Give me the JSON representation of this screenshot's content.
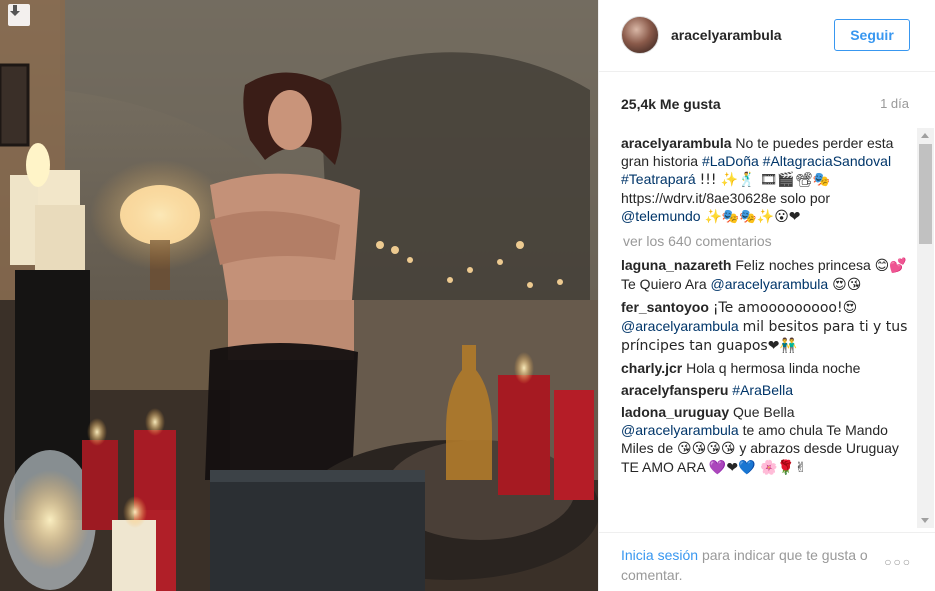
{
  "post": {
    "username": "aracelyarambula",
    "follow_label": "Seguir",
    "likes": "25,4k Me gusta",
    "time": "1 día",
    "caption": {
      "user": "aracelyarambula",
      "text1": "No te puedes perder esta gran historia",
      "tag1": "#LaDoña",
      "tag2": "#AltagraciaSandoval",
      "tag3": "#Teatrapará",
      "text2": "!!! ✨🕺",
      "emoji1": "🎞🎬📽🎭",
      "text3": "https://wdrv.it/8ae30628e solo por",
      "tag4": "@telemundo",
      "emoji2": "✨🎭🎭✨😮❤"
    },
    "view_comments": "ver los 640 comentarios",
    "comments": [
      {
        "user": "laguna_nazareth",
        "text1": "Feliz noches princesa",
        "emoji1": "😊💕",
        "text2": "Te Quiero Ara",
        "tag": "@aracelyarambula",
        "emoji2": "😍😘"
      },
      {
        "user": "fer_santoyoo",
        "text1": "¡Te amooooooooo!😍",
        "tag": "@aracelyarambula",
        "text2": "mil besitos para ti y tus príncipes tan guapos❤👬"
      },
      {
        "user": "charly.jcr",
        "text1": "Hola q hermosa linda noche"
      },
      {
        "user": "aracelyfansperu",
        "tag": "#AraBella"
      },
      {
        "user": "ladona_uruguay",
        "text1": "Que Bella",
        "tag": "@aracelyarambula",
        "text2": "te amo chula Te Mando Miles de",
        "emoji1": "😘😘😘😘",
        "text3": "y abrazos desde Uruguay TE AMO ARA",
        "emoji2": "💜❤💙 🌸🌹✌"
      }
    ],
    "footer": {
      "login_link": "Inicia sesión",
      "login_text": "para indicar que te gusta o comentar.",
      "more": "○○○"
    }
  }
}
